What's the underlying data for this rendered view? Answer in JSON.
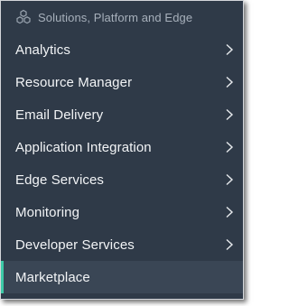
{
  "header": {
    "label": "Solutions, Platform and Edge",
    "icon": "solutions-cubes-icon"
  },
  "menu": {
    "items": [
      {
        "label": "Analytics",
        "has_submenu": true,
        "active": false
      },
      {
        "label": "Resource Manager",
        "has_submenu": true,
        "active": false
      },
      {
        "label": "Email Delivery",
        "has_submenu": true,
        "active": false
      },
      {
        "label": "Application Integration",
        "has_submenu": true,
        "active": false
      },
      {
        "label": "Edge Services",
        "has_submenu": true,
        "active": false
      },
      {
        "label": "Monitoring",
        "has_submenu": true,
        "active": false
      },
      {
        "label": "Developer Services",
        "has_submenu": true,
        "active": false
      },
      {
        "label": "Marketplace",
        "has_submenu": false,
        "active": true
      }
    ]
  },
  "colors": {
    "background": "#2f3a48",
    "active_background": "#3a4655",
    "active_accent": "#3ec9a7",
    "header_text": "#a7b0bb",
    "item_text": "#f2f4f6"
  }
}
